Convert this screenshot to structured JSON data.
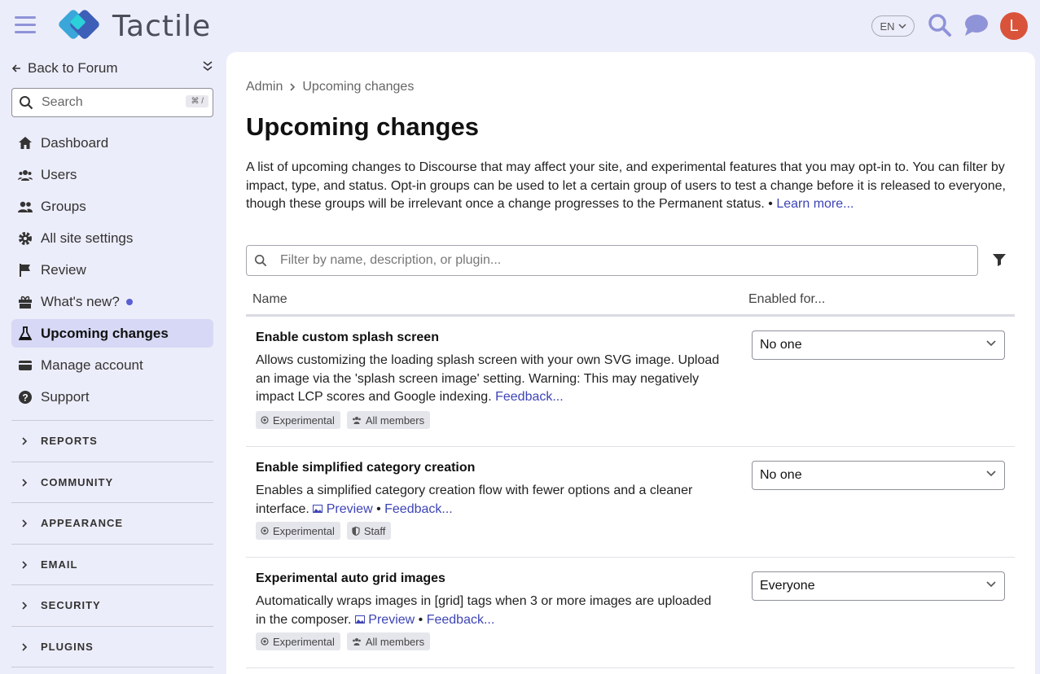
{
  "header": {
    "logo_text": "Tactile",
    "lang": "EN",
    "avatar_letter": "L"
  },
  "sidebar": {
    "back_label": "Back to Forum",
    "search_placeholder": "Search",
    "search_shortcut": "⌘ /",
    "items": [
      {
        "label": "Dashboard",
        "icon": "home-icon"
      },
      {
        "label": "Users",
        "icon": "users-icon"
      },
      {
        "label": "Groups",
        "icon": "groups-icon"
      },
      {
        "label": "All site settings",
        "icon": "gear-icon"
      },
      {
        "label": "Review",
        "icon": "flag-icon"
      },
      {
        "label": "What's new?",
        "icon": "gift-icon"
      },
      {
        "label": "Upcoming changes",
        "icon": "flask-icon"
      },
      {
        "label": "Manage account",
        "icon": "card-icon"
      },
      {
        "label": "Support",
        "icon": "question-icon"
      }
    ],
    "sections": [
      "REPORTS",
      "COMMUNITY",
      "APPEARANCE",
      "EMAIL",
      "SECURITY",
      "PLUGINS"
    ]
  },
  "main": {
    "breadcrumb": [
      "Admin",
      "Upcoming changes"
    ],
    "title": "Upcoming changes",
    "description": "A list of upcoming changes to Discourse that may affect your site, and experimental features that you may opt-in to. You can filter by impact, type, and status. Opt-in groups can be used to let a certain group of users to test a change before it is released to everyone, though these groups will be irrelevant once a change progresses to the Permanent status. • ",
    "learn_more": "Learn more...",
    "filter_placeholder": "Filter by name, description, or plugin...",
    "columns": {
      "name": "Name",
      "enabled": "Enabled for..."
    },
    "rows": [
      {
        "title": "Enable custom splash screen",
        "desc": "Allows customizing the loading splash screen with your own SVG image. Upload an image via the 'splash screen image' setting. Warning: This may negatively impact LCP scores and Google indexing. ",
        "preview": "",
        "feedback": "Feedback...",
        "tags": [
          "Experimental",
          "All members"
        ],
        "enabled_for": "No one"
      },
      {
        "title": "Enable simplified category creation",
        "desc": "Enables a simplified category creation flow with fewer options and a cleaner interface. ",
        "preview": "Preview",
        "feedback": "Feedback...",
        "tags": [
          "Experimental",
          "Staff"
        ],
        "enabled_for": "No one"
      },
      {
        "title": "Experimental auto grid images",
        "desc": "Automatically wraps images in [grid] tags when 3 or more images are uploaded in the composer. ",
        "preview": "Preview",
        "feedback": "Feedback...",
        "tags": [
          "Experimental",
          "All members"
        ],
        "enabled_for": "Everyone"
      }
    ]
  },
  "colors": {
    "accent": "#3d44b5",
    "sidebar_bg": "#ecedfa",
    "active_bg": "#d6d8f5",
    "avatar": "#d9533b"
  }
}
